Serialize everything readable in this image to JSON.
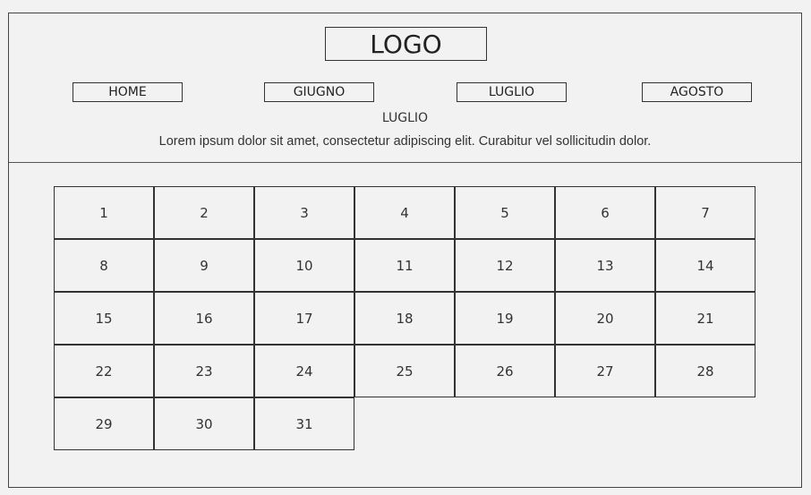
{
  "header": {
    "logo": "LOGO",
    "nav": [
      "HOME",
      "GIUGNO",
      "LUGLIO",
      "AGOSTO"
    ],
    "month_title": "LUGLIO",
    "description": "Lorem ipsum dolor sit amet, consectetur adipiscing elit. Curabitur vel sollicitudin dolor."
  },
  "calendar": {
    "days": [
      "1",
      "2",
      "3",
      "4",
      "5",
      "6",
      "7",
      "8",
      "9",
      "10",
      "11",
      "12",
      "13",
      "14",
      "15",
      "16",
      "17",
      "18",
      "19",
      "20",
      "21",
      "22",
      "23",
      "24",
      "25",
      "26",
      "27",
      "28",
      "29",
      "30",
      "31"
    ]
  }
}
